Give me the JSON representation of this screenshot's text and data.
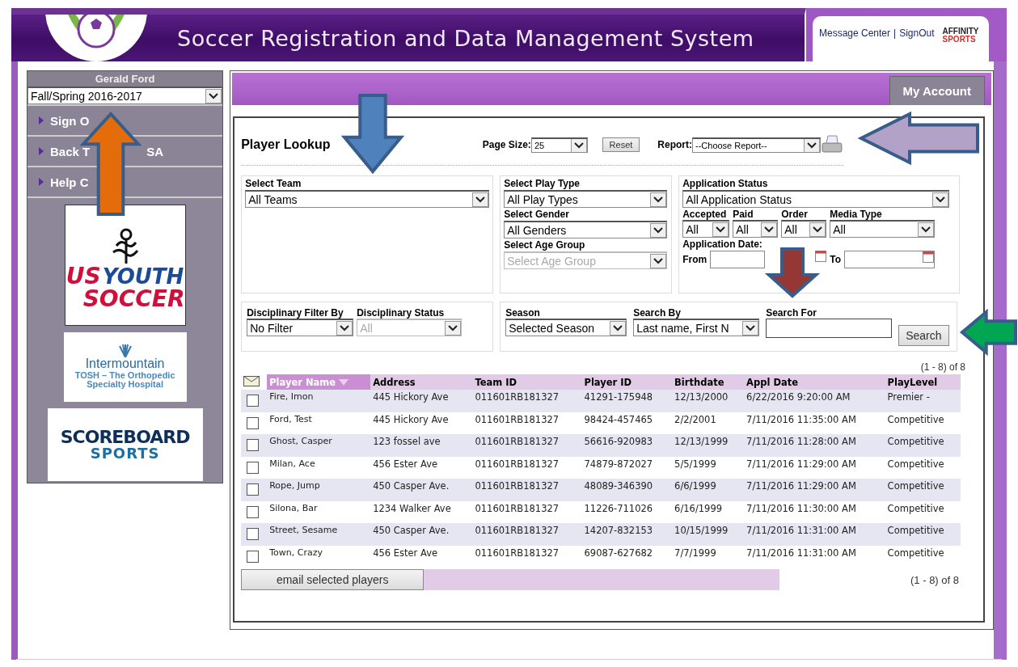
{
  "header": {
    "title": "Soccer Registration and Data Management System",
    "links": [
      "Message Center",
      "SignOut"
    ],
    "separator": "|",
    "brand": [
      "AFFINITY",
      "SPORTS"
    ]
  },
  "sidebar": {
    "user": "Gerald Ford",
    "season": {
      "value": "Fall/Spring 2016-2017",
      "disabled": false
    },
    "items": [
      {
        "parts": [
          "Sign O"
        ]
      },
      {
        "parts": [
          "Back T",
          "SA"
        ]
      },
      {
        "parts": [
          "Help C"
        ]
      }
    ],
    "sponsors": [
      {
        "kind": "usys",
        "lines": [
          "US",
          "YOUTH",
          "SOCCER"
        ]
      },
      {
        "kind": "tosh",
        "lines": [
          "Intermountain",
          "TOSH – The Orthopedic",
          "Specialty Hospital"
        ]
      },
      {
        "kind": "scoreboard",
        "lines": [
          "SCOREBOARD",
          "SPORTS"
        ]
      }
    ]
  },
  "account_tab": "My Account",
  "lookup": {
    "title": "Player Lookup",
    "page_size": {
      "label": "Page Size:",
      "value": "25",
      "disabled": false
    },
    "reset": "Reset",
    "report": {
      "label": "Report:",
      "value": "--Choose Report--",
      "disabled": false
    },
    "team": {
      "label": "Select Team",
      "value": "All Teams",
      "disabled": false
    },
    "play_type": {
      "label": "Select Play Type",
      "value": "All Play Types",
      "disabled": false
    },
    "gender": {
      "label": "Select Gender",
      "value": "All Genders",
      "disabled": false
    },
    "age_group": {
      "label": "Select Age Group",
      "value": "Select Age Group",
      "disabled": true
    },
    "application_status": {
      "label": "Application Status",
      "value": "All Application Status",
      "disabled": false
    },
    "small_filters": [
      {
        "label": "Accepted",
        "value": "All",
        "disabled": false
      },
      {
        "label": "Paid",
        "value": "All",
        "disabled": false
      },
      {
        "label": "Order",
        "value": "All",
        "disabled": false
      },
      {
        "label": "Media Type",
        "value": "All",
        "disabled": false
      }
    ],
    "application_date": {
      "label": "Application Date:",
      "from": "From",
      "to": "To"
    },
    "disciplinary_filter": {
      "label": "Disciplinary Filter By",
      "value": "No Filter",
      "disabled": false
    },
    "disciplinary_status": {
      "label": "Disciplinary Status",
      "value": "All",
      "disabled": true
    },
    "season": {
      "label": "Season",
      "value": "Selected Season",
      "disabled": false
    },
    "search_by": {
      "label": "Search By",
      "value": "Last name, First N",
      "disabled": false
    },
    "search_for": {
      "label": "Search For"
    },
    "search_button": "Search"
  },
  "table": {
    "count_top": "(1 - 8) of 8",
    "columns": [
      {
        "label": "Player Name",
        "sorted": true
      },
      {
        "label": "Address",
        "sorted": false
      },
      {
        "label": "Team ID",
        "sorted": false
      },
      {
        "label": "Player ID",
        "sorted": false
      },
      {
        "label": "Birthdate",
        "sorted": false
      },
      {
        "label": "Appl Date",
        "sorted": false
      },
      {
        "label": "PlayLevel",
        "sorted": false
      }
    ],
    "rows": [
      {
        "checked": false,
        "cells": [
          "Fire, Imon",
          "445 Hickory Ave",
          "011601RB181327",
          "41291-175948",
          "12/13/2000",
          "6/22/2016 9:20:00 AM",
          "Premier -"
        ]
      },
      {
        "checked": false,
        "cells": [
          "Ford, Test",
          "445 Hickory Ave",
          "011601RB181327",
          "98424-457465",
          "2/2/2001",
          "7/11/2016 11:35:00 AM",
          "Competitive"
        ]
      },
      {
        "checked": false,
        "cells": [
          "Ghost, Casper",
          "123 fossel ave",
          "011601RB181327",
          "56616-920983",
          "12/13/1999",
          "7/11/2016 11:28:00 AM",
          "Competitive"
        ]
      },
      {
        "checked": false,
        "cells": [
          "Milan, Ace",
          "456 Ester Ave",
          "011601RB181327",
          "74879-872027",
          "5/5/1999",
          "7/11/2016 11:29:00 AM",
          "Competitive"
        ]
      },
      {
        "checked": false,
        "cells": [
          "Rope, Jump",
          "450 Casper Ave.",
          "011601RB181327",
          "48089-346390",
          "6/6/1999",
          "7/11/2016 11:29:00 AM",
          "Competitive"
        ]
      },
      {
        "checked": false,
        "cells": [
          "Silona, Bar",
          "1234 Walker Ave",
          "011601RB181327",
          "11226-711026",
          "6/16/1999",
          "7/11/2016 11:30:00 AM",
          "Competitive"
        ]
      },
      {
        "checked": false,
        "cells": [
          "Street, Sesame",
          "450 Casper Ave.",
          "011601RB181327",
          "14207-832153",
          "10/15/1999",
          "7/11/2016 11:31:00 AM",
          "Competitive"
        ]
      },
      {
        "checked": false,
        "cells": [
          "Town, Crazy",
          "456 Ester Ave",
          "011601RB181327",
          "69087-627682",
          "7/7/1999",
          "7/11/2016 11:31:00 AM",
          "Competitive"
        ]
      }
    ],
    "email_button": "email selected players",
    "count_bottom": "(1 - 8) of 8"
  },
  "annotations": [
    {
      "kind": "up",
      "color": "#e46c0a"
    },
    {
      "kind": "down",
      "color": "#4f81bd"
    },
    {
      "kind": "left",
      "color": "#b3a2c7"
    },
    {
      "kind": "down",
      "color": "#953735"
    },
    {
      "kind": "left",
      "color": "#00a651"
    }
  ]
}
